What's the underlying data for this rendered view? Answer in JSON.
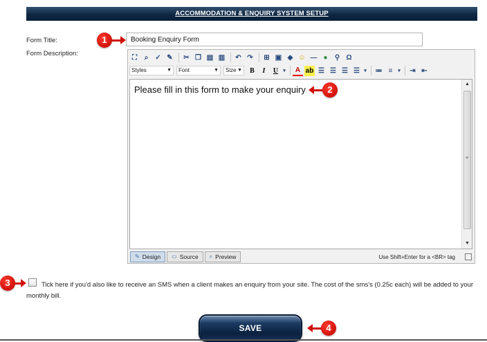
{
  "header": {
    "title": "ACCOMMODATION & ENQUIRY SYSTEM SETUP"
  },
  "form": {
    "title_label": "Form Title:",
    "title_value": "Booking Enquiry Form",
    "description_label": "Form Description:"
  },
  "editor": {
    "toolbar_row1_icons": [
      "fullscreen-icon",
      "find-icon",
      "spellcheck-icon",
      "format-painter-icon",
      "cut-icon",
      "copy-icon",
      "paste-icon",
      "paste-text-icon",
      "undo-icon",
      "redo-icon",
      "table-icon",
      "image-icon",
      "anchor-icon",
      "emoticon-icon",
      "horizontal-rule-icon",
      "media-icon",
      "link-icon",
      "special-char-icon"
    ],
    "styles_select": "Styles",
    "font_select": "Font",
    "size_select": "Size",
    "bold": "B",
    "italic": "I",
    "underline": "U",
    "content": "Please fill in this form to make your enquiry",
    "tabs": [
      {
        "label": "Design",
        "active": true
      },
      {
        "label": "Source",
        "active": false
      },
      {
        "label": "Preview",
        "active": false
      }
    ],
    "hint": "Use Shift+Enter for a <BR> tag"
  },
  "sms": {
    "checked": false,
    "text": "Tick here if you'd also like to receive an SMS when a client makes an enquiry from your site. The cost of the sms's (0.25c each) will be added to your monthly bill."
  },
  "save": {
    "label": "SAVE"
  },
  "callouts": [
    "1",
    "2",
    "3",
    "4"
  ],
  "colors": {
    "header_bg": "#0e2743",
    "callout": "#d0100a",
    "save_bg": "#0b2240"
  }
}
